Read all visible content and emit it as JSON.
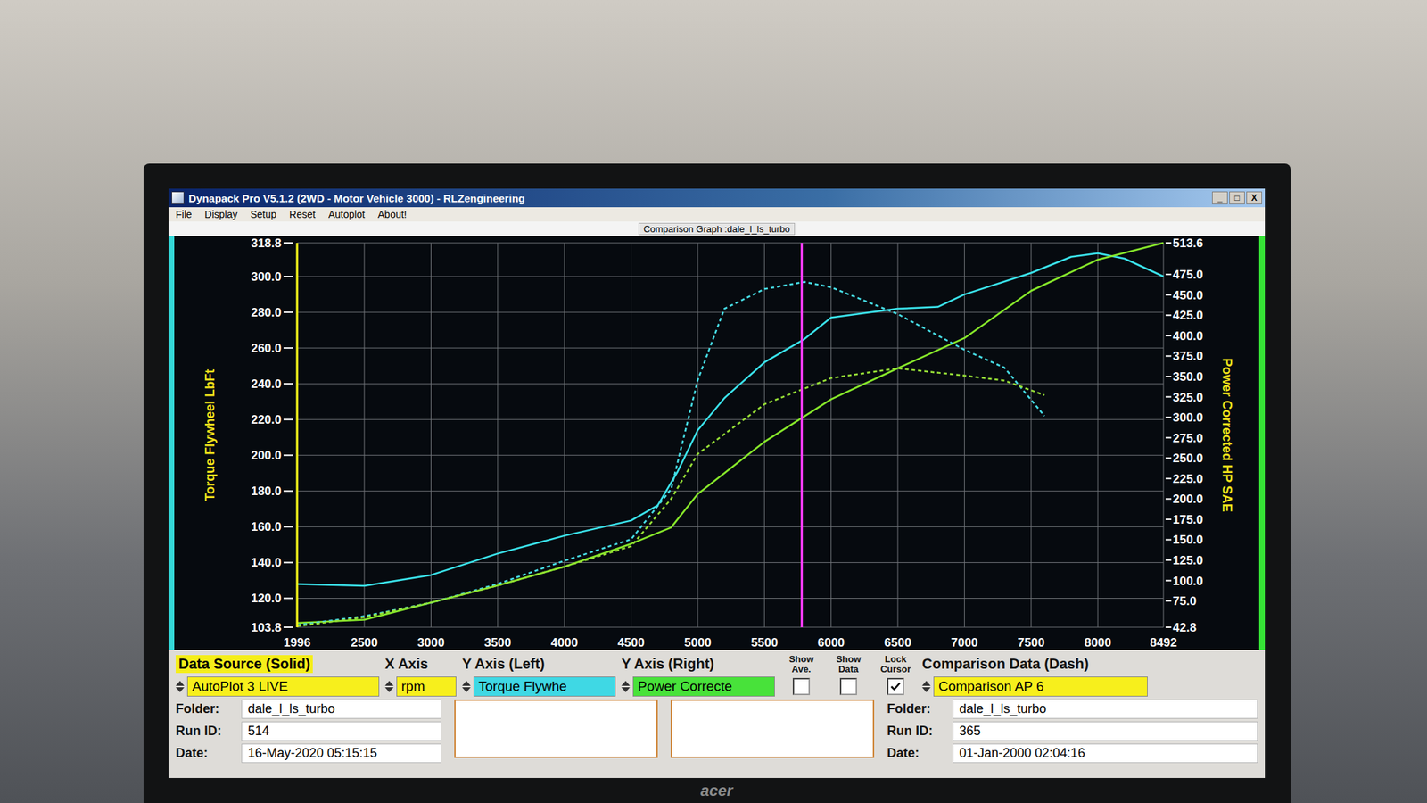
{
  "window": {
    "title": "Dynapack Pro V5.1.2 (2WD - Motor Vehicle 3000) - RLZengineering",
    "controls": [
      "_",
      "□",
      "X"
    ]
  },
  "menu": [
    "File",
    "Display",
    "Setup",
    "Reset",
    "Autoplot",
    "About!"
  ],
  "chart": {
    "title": "Comparison Graph :dale_l_ls_turbo",
    "x_axis": {
      "min": 1996,
      "max": 8492,
      "ticks": [
        "1996",
        "2500",
        "3000",
        "3500",
        "4000",
        "4500",
        "5000",
        "5500",
        "6000",
        "6500",
        "7000",
        "7500",
        "8000",
        "8492"
      ]
    },
    "y_left": {
      "title": "Torque Flywheel LbFt",
      "min": 103.8,
      "max": 318.8,
      "ticks": [
        "318.8",
        "300.0",
        "280.0",
        "260.0",
        "240.0",
        "220.0",
        "200.0",
        "180.0",
        "160.0",
        "140.0",
        "120.0",
        "103.8"
      ]
    },
    "y_right": {
      "title": "Power Corrected HP SAE",
      "min": 42.8,
      "max": 513.6,
      "ticks": [
        "513.6",
        "475.0",
        "450.0",
        "425.0",
        "400.0",
        "375.0",
        "350.0",
        "325.0",
        "300.0",
        "275.0",
        "250.0",
        "225.0",
        "200.0",
        "175.0",
        "150.0",
        "125.0",
        "100.0",
        "75.0",
        "42.8"
      ]
    },
    "series": [
      {
        "axis": "left",
        "dashed": false,
        "color": "#3ae2ea",
        "rpm": [
          1996,
          2500,
          3000,
          3500,
          4000,
          4500,
          4700,
          4850,
          5000,
          5200,
          5500,
          5800,
          6000,
          6500,
          6800,
          7000,
          7500,
          7800,
          8000,
          8200,
          8492
        ],
        "values": [
          128,
          127,
          133,
          145,
          155,
          163.5,
          172,
          191,
          214,
          232,
          252,
          265,
          277,
          282,
          283,
          290,
          302,
          311,
          313,
          310,
          300
        ]
      },
      {
        "axis": "right",
        "dashed": false,
        "color": "#86e62a",
        "rpm": [
          1996,
          2500,
          3000,
          3500,
          4000,
          4500,
          4800,
          5000,
          5500,
          6000,
          6500,
          7000,
          7500,
          8000,
          8492
        ],
        "values": [
          48,
          52,
          73,
          94,
          117,
          145,
          165,
          206,
          270,
          322,
          360,
          397,
          455,
          493,
          513.6
        ]
      },
      {
        "axis": "left",
        "dashed": true,
        "color": "#46dce4",
        "rpm": [
          1996,
          2500,
          3000,
          3500,
          4000,
          4500,
          4800,
          5000,
          5200,
          5500,
          5800,
          6000,
          6500,
          7000,
          7300,
          7600
        ],
        "values": [
          105,
          110,
          117.5,
          128,
          141,
          153,
          181,
          242,
          282,
          293,
          297,
          294,
          279,
          259,
          249,
          222
        ]
      },
      {
        "axis": "right",
        "dashed": true,
        "color": "#96de36",
        "rpm": [
          1996,
          2500,
          3000,
          3500,
          4000,
          4500,
          4800,
          5000,
          5500,
          6000,
          6500,
          7000,
          7300,
          7600
        ],
        "values": [
          44,
          55,
          73,
          94,
          117,
          142,
          200,
          255,
          316,
          348,
          360,
          351,
          345,
          327
        ]
      }
    ],
    "cursors": [
      {
        "rpm": 1996,
        "color": "#f2f21a"
      },
      {
        "rpm": 5780,
        "color": "#ff3cff"
      }
    ]
  },
  "controls": {
    "data_source": {
      "label": "Data Source (Solid)",
      "value": "AutoPlot 3 LIVE"
    },
    "x_axis": {
      "label": "X Axis",
      "value": "rpm"
    },
    "y_left": {
      "label": "Y Axis (Left)",
      "value": "Torque Flywhe"
    },
    "y_right": {
      "label": "Y Axis (Right)",
      "value": "Power Correcte"
    },
    "checkboxes": [
      {
        "label": "Show Ave.",
        "checked": false
      },
      {
        "label": "Show Data",
        "checked": false
      },
      {
        "label": "Lock Cursor",
        "checked": true
      }
    ],
    "comparison": {
      "label": "Comparison Data (Dash)",
      "value": "Comparison AP 6"
    }
  },
  "solid_run": [
    {
      "label": "Folder:",
      "value": "dale_l_ls_turbo"
    },
    {
      "label": "Run ID:",
      "value": "514"
    },
    {
      "label": "Date:",
      "value": "16-May-2020 05:15:15"
    }
  ],
  "dash_run": [
    {
      "label": "Folder:",
      "value": "dale_l_ls_turbo"
    },
    {
      "label": "Run ID:",
      "value": "365"
    },
    {
      "label": "Date:",
      "value": "01-Jan-2000 02:04:16"
    }
  ],
  "monitor": {
    "brand": "acer"
  }
}
